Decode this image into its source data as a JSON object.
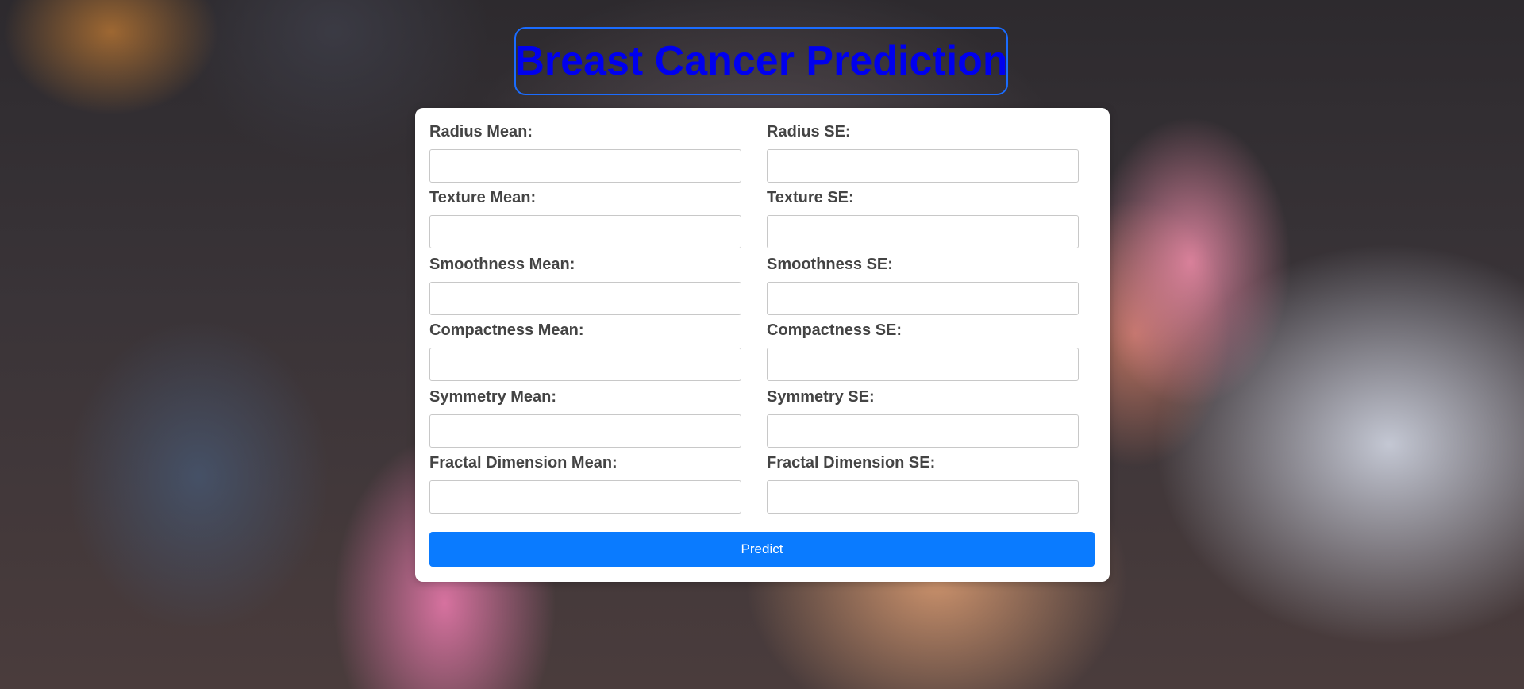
{
  "page": {
    "title": "Breast Cancer Prediction",
    "accent_color": "#0a7bff",
    "title_color": "#0000ee"
  },
  "form": {
    "fields": [
      {
        "label": "Radius Mean:",
        "value": "",
        "placeholder": ""
      },
      {
        "label": "Radius SE:",
        "value": "",
        "placeholder": ""
      },
      {
        "label": "Texture Mean:",
        "value": "",
        "placeholder": ""
      },
      {
        "label": "Texture SE:",
        "value": "",
        "placeholder": ""
      },
      {
        "label": "Smoothness Mean:",
        "value": "",
        "placeholder": ""
      },
      {
        "label": "Smoothness SE:",
        "value": "",
        "placeholder": ""
      },
      {
        "label": "Compactness Mean:",
        "value": "",
        "placeholder": ""
      },
      {
        "label": "Compactness SE:",
        "value": "",
        "placeholder": ""
      },
      {
        "label": "Symmetry Mean:",
        "value": "",
        "placeholder": ""
      },
      {
        "label": "Symmetry SE:",
        "value": "",
        "placeholder": ""
      },
      {
        "label": "Fractal Dimension Mean:",
        "value": "",
        "placeholder": ""
      },
      {
        "label": "Fractal Dimension SE:",
        "value": "",
        "placeholder": ""
      }
    ],
    "submit_label": "Predict"
  }
}
